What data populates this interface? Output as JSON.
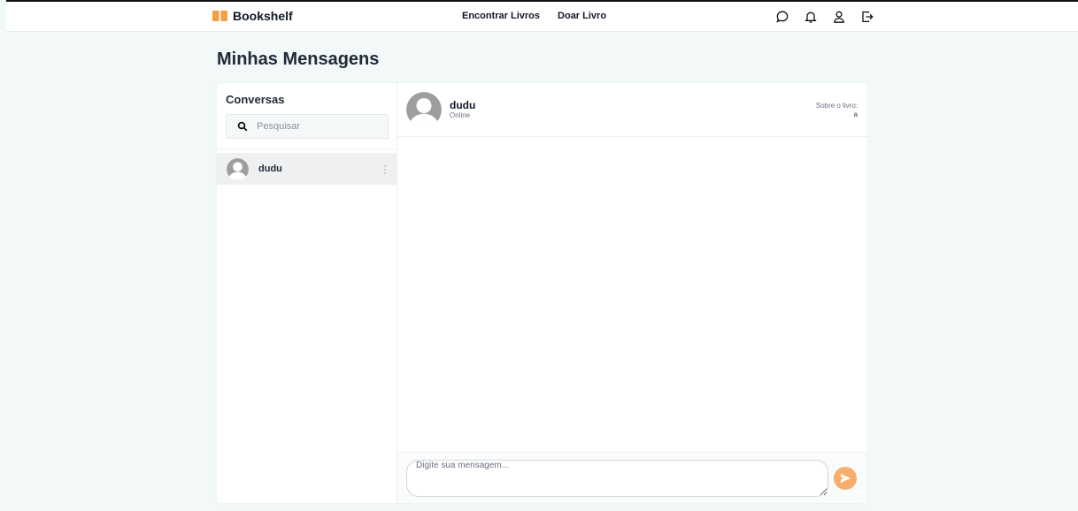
{
  "app": {
    "name": "Bookshelf",
    "logo_icon": "open-book-icon",
    "accent": "#f59e42"
  },
  "nav": {
    "items": [
      {
        "label": "Encontrar Livros"
      },
      {
        "label": "Doar Livro"
      }
    ]
  },
  "header_icons": [
    "chat-icon",
    "bell-icon",
    "user-icon",
    "logout-icon"
  ],
  "page": {
    "title": "Minhas Mensagens"
  },
  "sidebar": {
    "title": "Conversas",
    "search": {
      "placeholder": "Pesquisar",
      "value": ""
    },
    "conversations": [
      {
        "name": "dudu",
        "selected": true
      }
    ]
  },
  "chat": {
    "contact": {
      "name": "dudu",
      "status": "Online"
    },
    "book": {
      "label": "Sobre o livro:",
      "title": "a"
    },
    "messages": [],
    "composer": {
      "placeholder": "Digite sua mensagem...",
      "value": ""
    },
    "send_color": "#f7ae6c"
  }
}
